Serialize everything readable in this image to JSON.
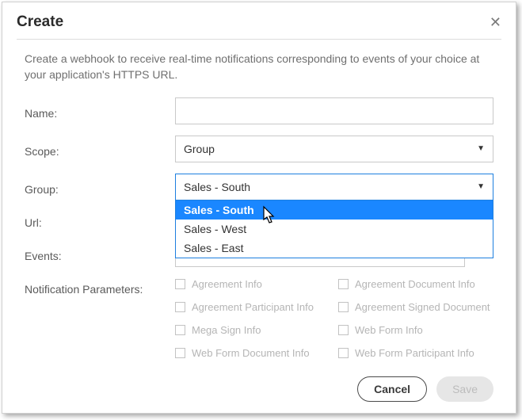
{
  "dialog": {
    "title": "Create",
    "description": "Create a webhook to receive real-time notifications corresponding to events of your choice at your application's HTTPS URL."
  },
  "labels": {
    "name": "Name:",
    "scope": "Scope:",
    "group": "Group:",
    "url": "Url:",
    "events": "Events:",
    "notification_params": "Notification Parameters:"
  },
  "fields": {
    "name_value": "",
    "scope_value": "Group",
    "group_value": "Sales - South",
    "url_value": ""
  },
  "group_options": [
    {
      "label": "Sales - South",
      "selected": true
    },
    {
      "label": "Sales - West",
      "selected": false
    },
    {
      "label": "Sales - East",
      "selected": false
    }
  ],
  "params": {
    "p0": "Agreement Info",
    "p1": "Agreement Document Info",
    "p2": "Agreement Participant Info",
    "p3": "Agreement Signed Document",
    "p4": "Mega Sign Info",
    "p5": "Web Form Info",
    "p6": "Web Form Document Info",
    "p7": "Web Form Participant Info"
  },
  "buttons": {
    "cancel": "Cancel",
    "save": "Save"
  }
}
